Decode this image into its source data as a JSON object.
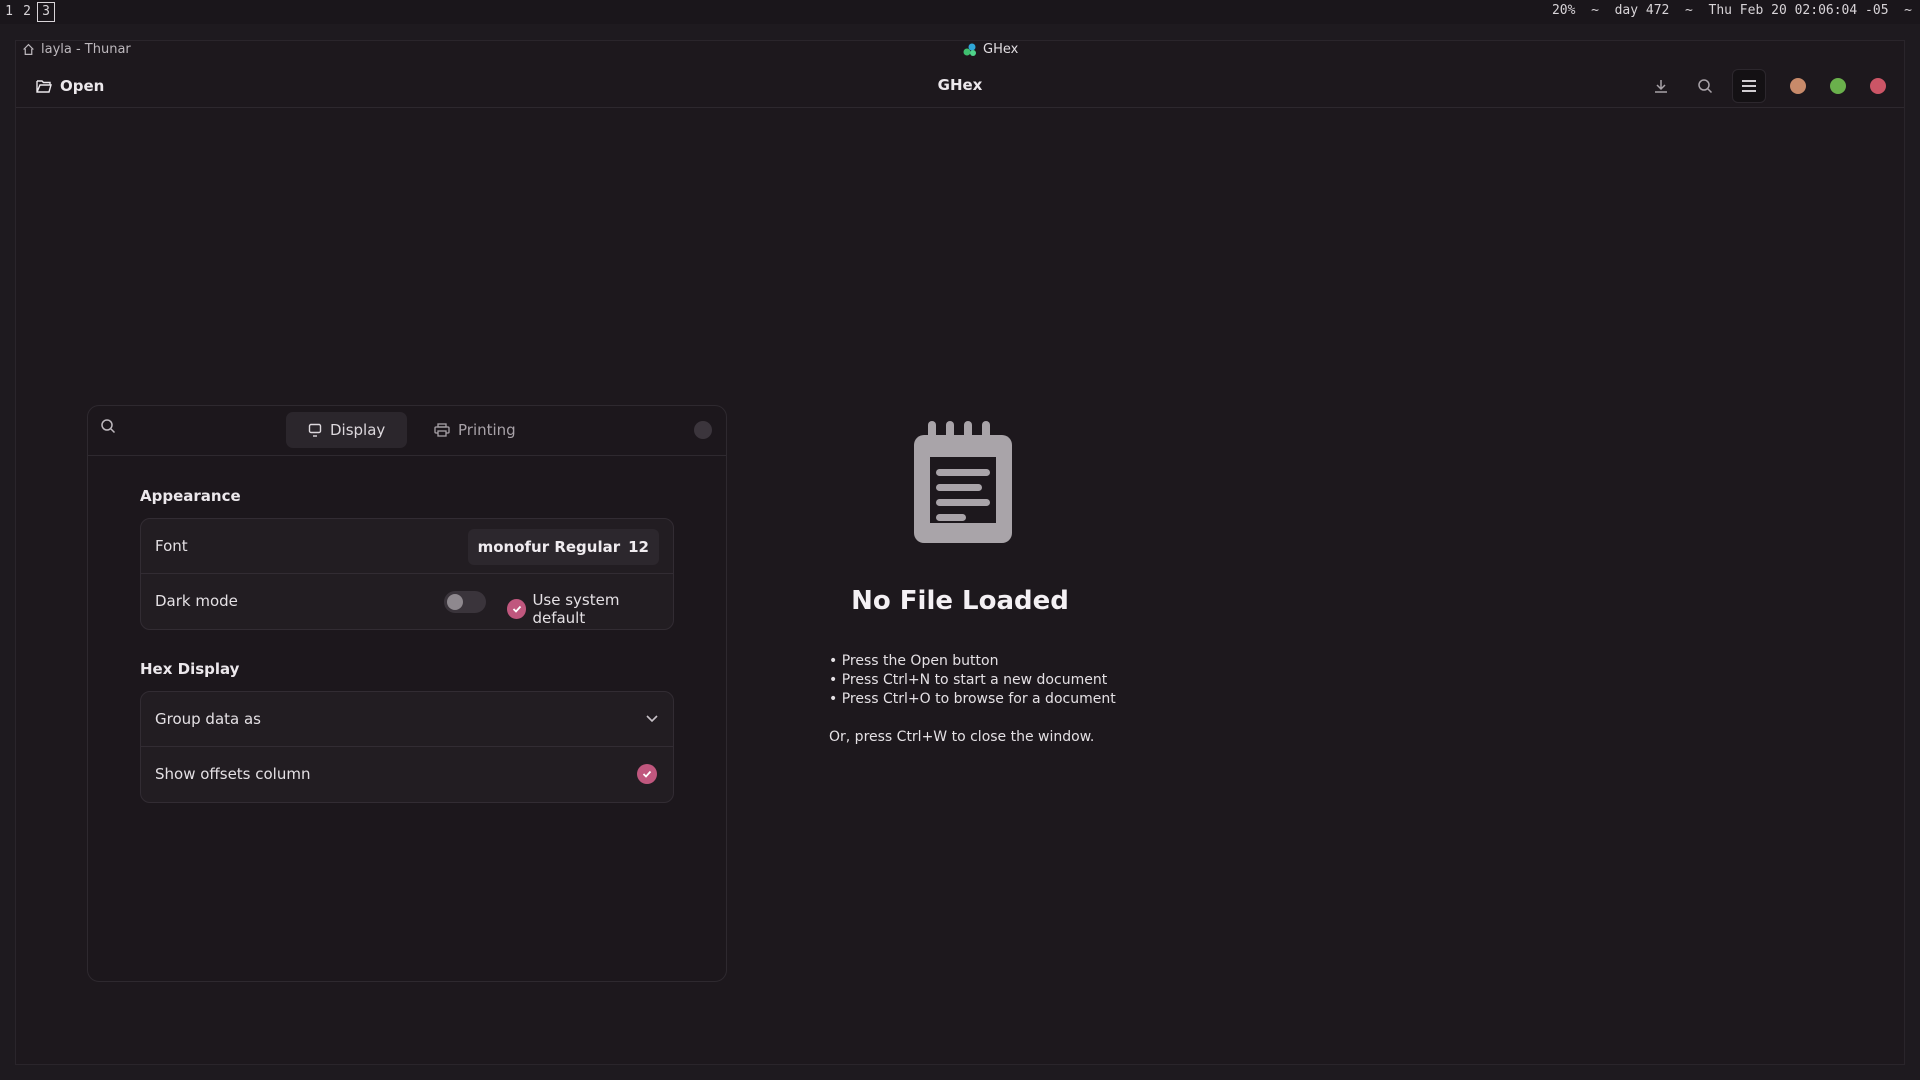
{
  "topbar": {
    "workspaces": [
      "1",
      "2",
      "3"
    ],
    "active_workspace": "3",
    "status": "20%  ~  day 472  ~  Thu Feb 20 02:06:04 -05  ~"
  },
  "titlebar": {
    "thunar": "layla - Thunar",
    "app": "GHex"
  },
  "header": {
    "open_label": "Open",
    "title": "GHex"
  },
  "prefs": {
    "tabs": [
      {
        "label": "Display",
        "active": true
      },
      {
        "label": "Printing",
        "active": false
      }
    ],
    "appearance": {
      "title": "Appearance",
      "font_label": "Font",
      "font_name": "monofur Regular",
      "font_size": "12",
      "dark_mode_label": "Dark mode",
      "dark_mode_on": false,
      "system_default_label": "Use system default",
      "system_default_checked": true
    },
    "hex_display": {
      "title": "Hex Display",
      "group_label": "Group data as",
      "offsets_label": "Show offsets column",
      "offsets_checked": true
    }
  },
  "empty_state": {
    "title": "No File Loaded",
    "items": [
      "• Press the Open button",
      "• Press Ctrl+N to start a new document",
      "• Press Ctrl+O to browse for a document"
    ],
    "footer": "Or, press Ctrl+W to close the window."
  },
  "colors": {
    "accent": "#c0577e",
    "window_min": "#c88a6a",
    "window_max": "#6ab04c",
    "window_close": "#cc5566"
  }
}
